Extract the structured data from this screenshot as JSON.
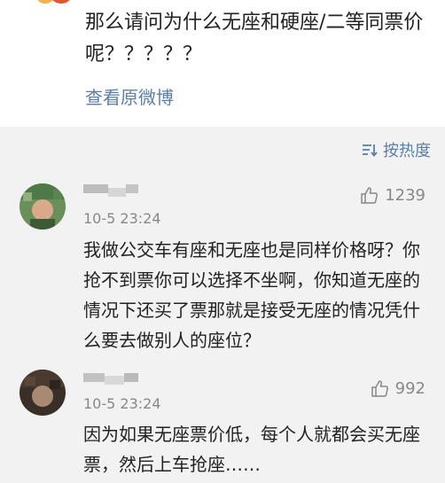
{
  "post": {
    "text": "那么请问为什么无座和硬座/二等同票价呢？？？？？",
    "view_original": "查看原微博"
  },
  "sort": {
    "label": "按热度",
    "icon": "sort-icon"
  },
  "comments": [
    {
      "time": "10-5 23:24",
      "likes": "1239",
      "text": "我做公交车有座和无座也是同样价格呀？你抢不到票你可以选择不坐啊，你知道无座的情况下还买了票那就是接受无座的情况凭什么要去做别人的座位？"
    },
    {
      "time": "10-5 23:24",
      "likes": "992",
      "text": "因为如果无座票价低，每个人就都会买无座票，然后上车抢座……"
    }
  ],
  "colors": {
    "link": "#5b7fa6",
    "muted": "#888888",
    "background": "#f2f2f2"
  }
}
